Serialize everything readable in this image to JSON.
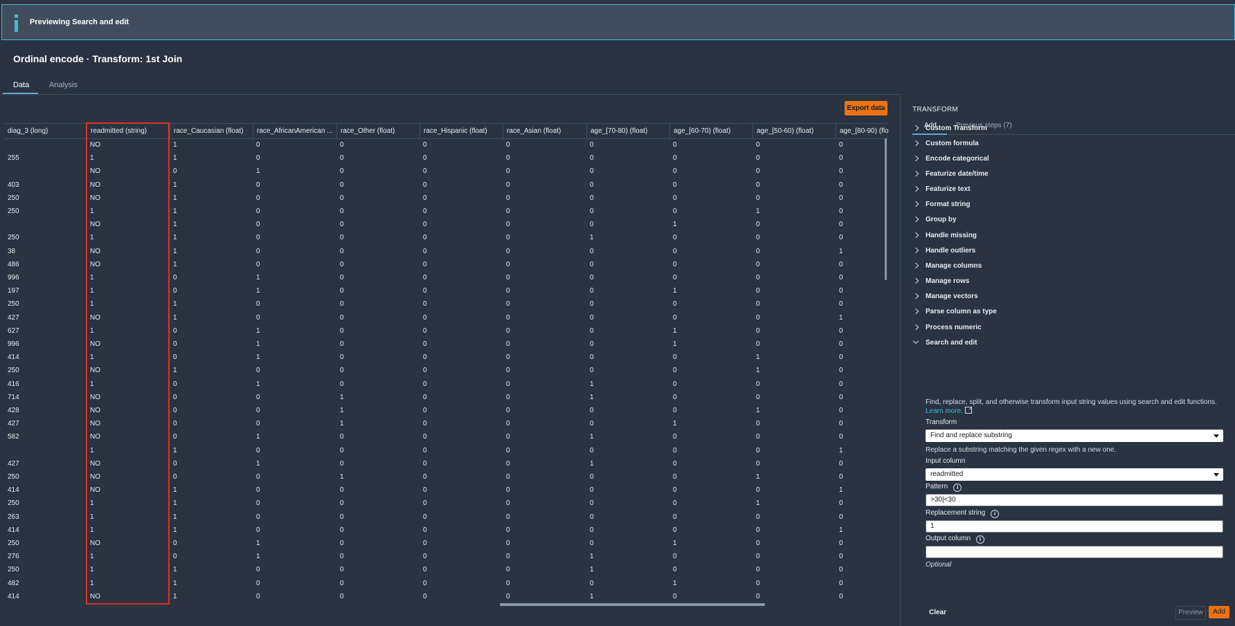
{
  "banner": {
    "text": "Previewing Search and edit"
  },
  "page": {
    "title": "Ordinal encode · Transform: 1st Join"
  },
  "tabs": [
    {
      "label": "Data"
    },
    {
      "label": "Analysis"
    }
  ],
  "toolbar": {
    "export_label": "Export data"
  },
  "table": {
    "columns": [
      "diag_3 (long)",
      "readmitted (string)",
      "race_Caucasian (float)",
      "race_AfricanAmerican ...",
      "race_Other (float)",
      "race_Hispanic (float)",
      "race_Asian (float)",
      "age_[70-80) (float)",
      "age_[60-70) (float)",
      "age_[50-60) (float)",
      "age_[80-90) (flo"
    ],
    "rows": [
      [
        "",
        "NO",
        "1",
        "0",
        "0",
        "0",
        "0",
        "0",
        "0",
        "0",
        "0"
      ],
      [
        "255",
        "1",
        "1",
        "0",
        "0",
        "0",
        "0",
        "0",
        "0",
        "0",
        "0"
      ],
      [
        "",
        "NO",
        "0",
        "1",
        "0",
        "0",
        "0",
        "0",
        "0",
        "0",
        "0"
      ],
      [
        "403",
        "NO",
        "1",
        "0",
        "0",
        "0",
        "0",
        "0",
        "0",
        "0",
        "0"
      ],
      [
        "250",
        "NO",
        "1",
        "0",
        "0",
        "0",
        "0",
        "0",
        "0",
        "0",
        "0"
      ],
      [
        "250",
        "1",
        "1",
        "0",
        "0",
        "0",
        "0",
        "0",
        "0",
        "1",
        "0"
      ],
      [
        "",
        "NO",
        "1",
        "0",
        "0",
        "0",
        "0",
        "0",
        "1",
        "0",
        "0"
      ],
      [
        "250",
        "1",
        "1",
        "0",
        "0",
        "0",
        "0",
        "1",
        "0",
        "0",
        "0"
      ],
      [
        "38",
        "NO",
        "1",
        "0",
        "0",
        "0",
        "0",
        "0",
        "0",
        "0",
        "1"
      ],
      [
        "486",
        "NO",
        "1",
        "0",
        "0",
        "0",
        "0",
        "0",
        "0",
        "0",
        "0"
      ],
      [
        "996",
        "1",
        "0",
        "1",
        "0",
        "0",
        "0",
        "0",
        "0",
        "0",
        "0"
      ],
      [
        "197",
        "1",
        "0",
        "1",
        "0",
        "0",
        "0",
        "0",
        "1",
        "0",
        "0"
      ],
      [
        "250",
        "1",
        "1",
        "0",
        "0",
        "0",
        "0",
        "0",
        "0",
        "0",
        "0"
      ],
      [
        "427",
        "NO",
        "1",
        "0",
        "0",
        "0",
        "0",
        "0",
        "0",
        "0",
        "1"
      ],
      [
        "627",
        "1",
        "0",
        "1",
        "0",
        "0",
        "0",
        "0",
        "1",
        "0",
        "0"
      ],
      [
        "996",
        "NO",
        "0",
        "1",
        "0",
        "0",
        "0",
        "0",
        "1",
        "0",
        "0"
      ],
      [
        "414",
        "1",
        "0",
        "1",
        "0",
        "0",
        "0",
        "0",
        "0",
        "1",
        "0"
      ],
      [
        "250",
        "NO",
        "1",
        "0",
        "0",
        "0",
        "0",
        "0",
        "0",
        "1",
        "0"
      ],
      [
        "416",
        "1",
        "0",
        "1",
        "0",
        "0",
        "0",
        "1",
        "0",
        "0",
        "0"
      ],
      [
        "714",
        "NO",
        "0",
        "0",
        "1",
        "0",
        "0",
        "1",
        "0",
        "0",
        "0"
      ],
      [
        "428",
        "NO",
        "0",
        "0",
        "1",
        "0",
        "0",
        "0",
        "0",
        "1",
        "0"
      ],
      [
        "427",
        "NO",
        "0",
        "0",
        "1",
        "0",
        "0",
        "0",
        "1",
        "0",
        "0"
      ],
      [
        "582",
        "NO",
        "0",
        "1",
        "0",
        "0",
        "0",
        "1",
        "0",
        "0",
        "0"
      ],
      [
        "",
        "1",
        "1",
        "0",
        "0",
        "0",
        "0",
        "0",
        "0",
        "0",
        "1"
      ],
      [
        "427",
        "NO",
        "0",
        "1",
        "0",
        "0",
        "0",
        "1",
        "0",
        "0",
        "0"
      ],
      [
        "250",
        "NO",
        "0",
        "0",
        "1",
        "0",
        "0",
        "0",
        "0",
        "1",
        "0"
      ],
      [
        "414",
        "NO",
        "1",
        "0",
        "0",
        "0",
        "0",
        "0",
        "0",
        "0",
        "1"
      ],
      [
        "250",
        "1",
        "1",
        "0",
        "0",
        "0",
        "0",
        "0",
        "0",
        "1",
        "0"
      ],
      [
        "263",
        "1",
        "1",
        "0",
        "0",
        "0",
        "0",
        "0",
        "0",
        "0",
        "0"
      ],
      [
        "414",
        "1",
        "1",
        "0",
        "0",
        "0",
        "0",
        "0",
        "0",
        "0",
        "1"
      ],
      [
        "250",
        "NO",
        "0",
        "1",
        "0",
        "0",
        "0",
        "0",
        "1",
        "0",
        "0"
      ],
      [
        "276",
        "1",
        "0",
        "1",
        "0",
        "0",
        "0",
        "1",
        "0",
        "0",
        "0"
      ],
      [
        "250",
        "1",
        "1",
        "0",
        "0",
        "0",
        "0",
        "1",
        "0",
        "0",
        "0"
      ],
      [
        "482",
        "1",
        "1",
        "0",
        "0",
        "0",
        "0",
        "0",
        "1",
        "0",
        "0"
      ],
      [
        "414",
        "NO",
        "1",
        "0",
        "0",
        "0",
        "0",
        "1",
        "0",
        "0",
        "0"
      ]
    ]
  },
  "panel": {
    "title": "TRANSFORM",
    "tabs": [
      {
        "label": "Add"
      },
      {
        "label": "Previous steps (7)"
      }
    ],
    "items": [
      {
        "label": "Custom Transform"
      },
      {
        "label": "Custom formula"
      },
      {
        "label": "Encode categorical"
      },
      {
        "label": "Featurize date/time"
      },
      {
        "label": "Featurize text"
      },
      {
        "label": "Format string"
      },
      {
        "label": "Group by"
      },
      {
        "label": "Handle missing"
      },
      {
        "label": "Handle outliers"
      },
      {
        "label": "Manage columns"
      },
      {
        "label": "Manage rows"
      },
      {
        "label": "Manage vectors"
      },
      {
        "label": "Parse column as type"
      },
      {
        "label": "Process numeric"
      },
      {
        "label": "Search and edit"
      }
    ],
    "search_edit": {
      "description": "Find, replace, split, and otherwise transform input string values using search and edit functions.",
      "learn_more": "Learn more.",
      "transform_label": "Transform",
      "transform_value": "Find and replace substring",
      "transform_help": "Replace a substring matching the given regex with a new one.",
      "input_column_label": "Input column",
      "input_column_value": "readmitted",
      "pattern_label": "Pattern",
      "pattern_value": ">30|<30",
      "replacement_label": "Replacement string",
      "replacement_value": "1",
      "output_column_label": "Output column",
      "output_column_value": "",
      "optional_text": "Optional"
    },
    "actions": {
      "clear": "Clear",
      "preview": "Preview",
      "add": "Add"
    }
  },
  "colors": {
    "accent": "#ec7211",
    "highlight": "#e0301e",
    "info": "#44b9d6"
  }
}
